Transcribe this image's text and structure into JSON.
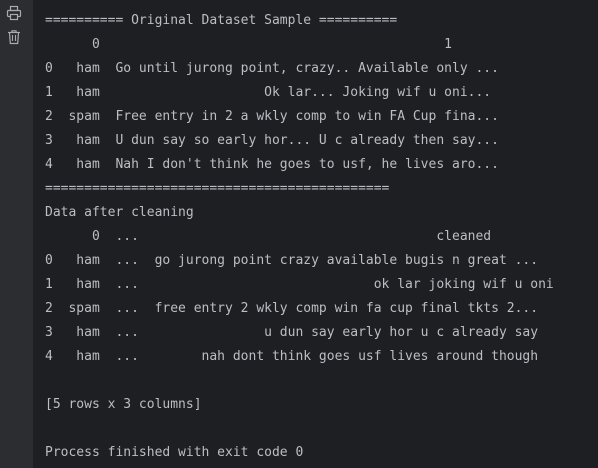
{
  "toolbar": {
    "print_icon": "printer-icon",
    "delete_icon": "trash-icon"
  },
  "console": {
    "lines": [
      "========== Original Dataset Sample ==========",
      "      0                                            1",
      "0   ham  Go until jurong point, crazy.. Available only ...",
      "1   ham                     Ok lar... Joking wif u oni...",
      "2  spam  Free entry in 2 a wkly comp to win FA Cup fina...",
      "3   ham  U dun say so early hor... U c already then say...",
      "4   ham  Nah I don't think he goes to usf, he lives aro...",
      "============================================",
      "Data after cleaning",
      "      0  ...                                      cleaned",
      "0   ham  ...  go jurong point crazy available bugis n great ...",
      "1   ham  ...                              ok lar joking wif u oni",
      "2  spam  ...  free entry 2 wkly comp win fa cup final tkts 2...",
      "3   ham  ...                u dun say early hor u c already say",
      "4   ham  ...        nah dont think goes usf lives around though",
      "",
      "[5 rows x 3 columns]",
      "",
      "Process finished with exit code 0"
    ]
  },
  "colors": {
    "background": "#1e1f22",
    "gutter": "#2b2d30",
    "text": "#bcbec4",
    "icon": "#a8abb0"
  }
}
